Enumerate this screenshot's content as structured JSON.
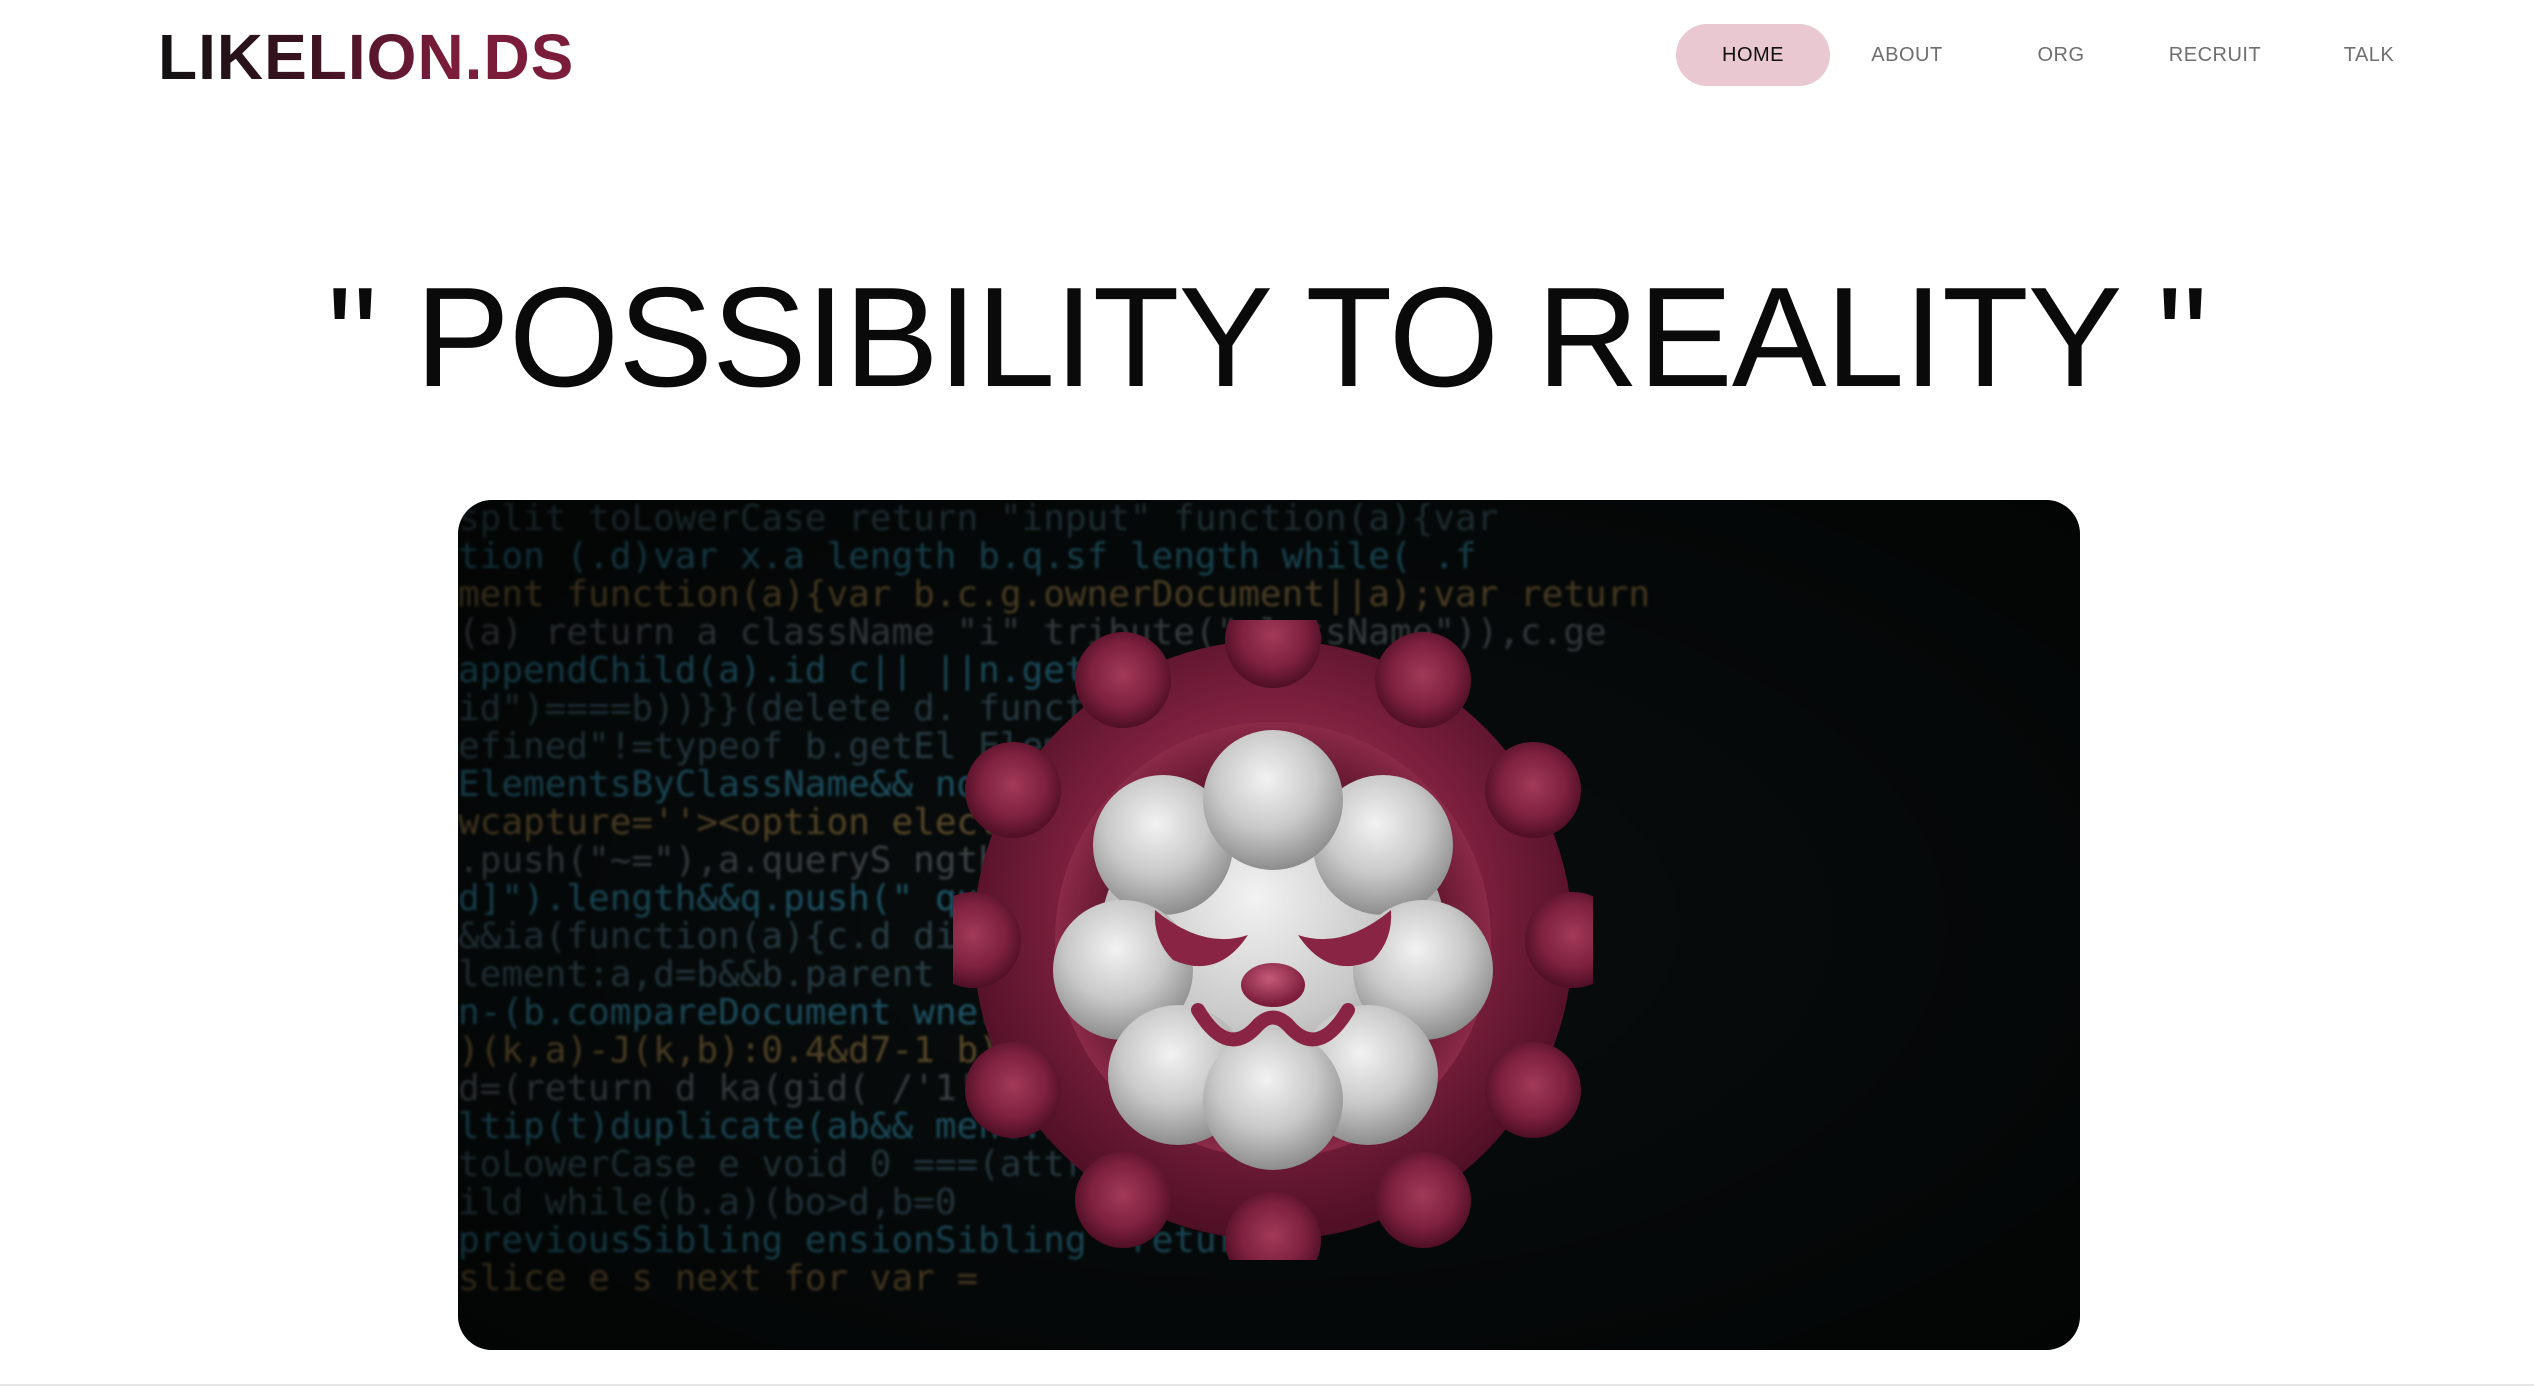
{
  "header": {
    "logo": "LIKELION.DS",
    "nav": [
      {
        "label": "HOME",
        "active": true
      },
      {
        "label": "ABOUT",
        "active": false
      },
      {
        "label": "ORG",
        "active": false
      },
      {
        "label": "RECRUIT",
        "active": false
      },
      {
        "label": "TALK",
        "active": false
      }
    ]
  },
  "hero": {
    "headline": "\" POSSIBILITY TO REALITY \"",
    "image": "lion-mascot-on-code-background",
    "code_lines": [
      "  split     toLowerCase      return \"input\"   function(a){var",
      "tion  (.d)var x.a   length  b.q.sf  length while(  .f",
      "ment  function(a){var b.c.g.ownerDocument||a);var return",
      "(a)  return  a className \"i\"    tribute(\"className\")),c.ge",
      "appendChild(a).id           c||   ||n.getElementsByName(",
      "id\")====b))}}(delete d.           function(a){var b=a.re",
      "efined\"!=typeof b.getEl           ElementsByTagName(a):",
      "ElementsByClassName&&             ndefined\"!==typeof b.ge",
      "wcapture=''><option              elect>\",a.querySelecto",
      ".push(\"~=\"),a.queryS            ngth||q.push(\":checke",
      "d]\").length&&q.push(\"             querySelectorAll(\":ena",
      "&&ia(function(a){c.d             div\"),s.call(a,\"[s!='",
      "lement:a,d=b&&b.parent            !==d.nodeType||!(c.co",
      "n-(b.compareDocument              wnerDocument||a)===(b",
      ")(k,a)-J(k,b):0.4&d7-1            b)return l=!0,0;var c",
      "d=(return d ka(gid(               /'1'0'),n)),fa.matche",
      "ltip(t)duplicate(ab&&               ment.nodeType)return",
      "      toLowerCase        e        void 0  ===(attribute",
      "ild                               while(b.a)(bo>d,b=0",
      "previousSibling             ensionSibling\"  return  a",
      "   slice   e   s                 next  for  var   ="
    ],
    "colors": {
      "mascot_ring": "#7a1c3a",
      "mascot_face": "#cfcfcf",
      "nav_active_bg": "#e9c8d1"
    }
  }
}
